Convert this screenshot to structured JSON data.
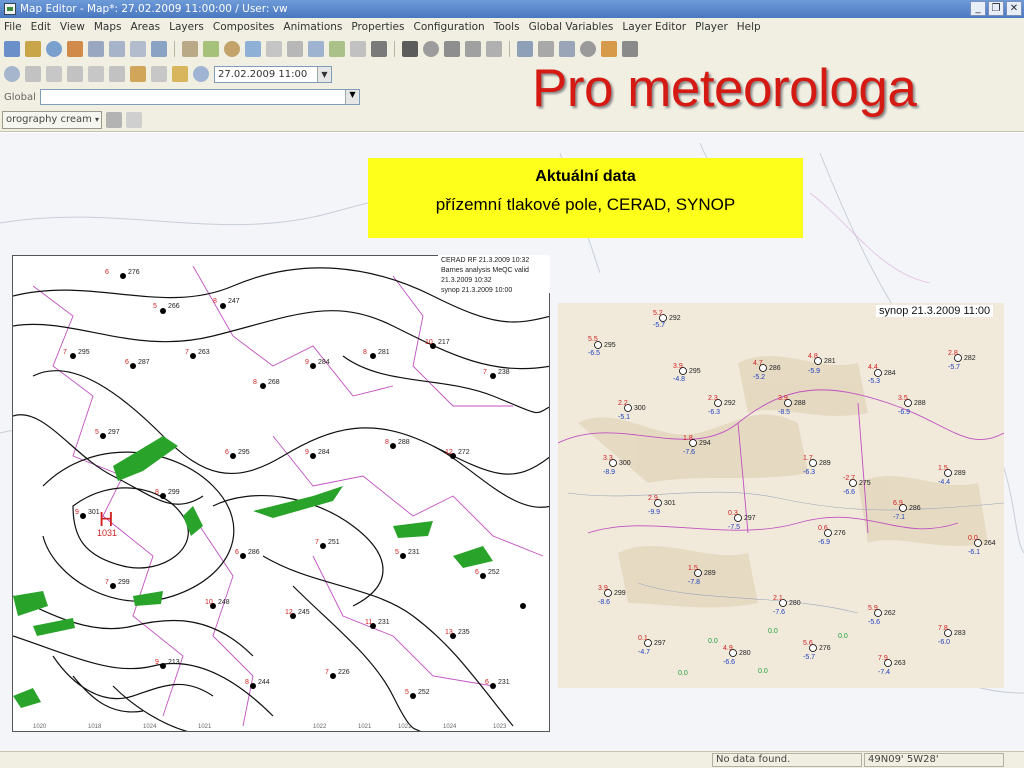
{
  "window": {
    "title": "Map Editor - Map*: 27.02.2009 11:00:00 / User: vw",
    "buttons": [
      "_",
      "❐",
      "✕"
    ]
  },
  "menu": [
    "File",
    "Edit",
    "View",
    "Maps",
    "Areas",
    "Layers",
    "Composites",
    "Animations",
    "Properties",
    "Configuration",
    "Tools",
    "Global Variables",
    "Layer Editor",
    "Player",
    "Help"
  ],
  "toolbar": {
    "date_value": "27.02.2009 11:00"
  },
  "global_row": {
    "label": "Global"
  },
  "layer_row": {
    "layer_name": "orography cream"
  },
  "slide": {
    "title": "Pro meteorologa",
    "box_title": "Aktuální data",
    "box_subtitle": "přízemní tlakové pole, CERAD, SYNOP"
  },
  "map_left": {
    "header_lines": [
      "CERAD RF  21.3.2009 10:32",
      "Barnes analysis MeQC valid 21.3.2009 10:32",
      "synop 21.3.2009 10:00"
    ],
    "high_label": "H",
    "high_value": "1031",
    "bottom_ticks": [
      "1020",
      "1018",
      "1024",
      "1021",
      "1022",
      "1021",
      "1021",
      "1024",
      "1023"
    ]
  },
  "map_right": {
    "label": "synop 21.3.2009 11:00"
  },
  "status": {
    "no_data": "No data found.",
    "coords": "49N09' 5W28'"
  },
  "colors": {
    "title_red": "#d51a14",
    "box_yellow": "#ffff1c",
    "radar_green": "#2aa32a"
  }
}
